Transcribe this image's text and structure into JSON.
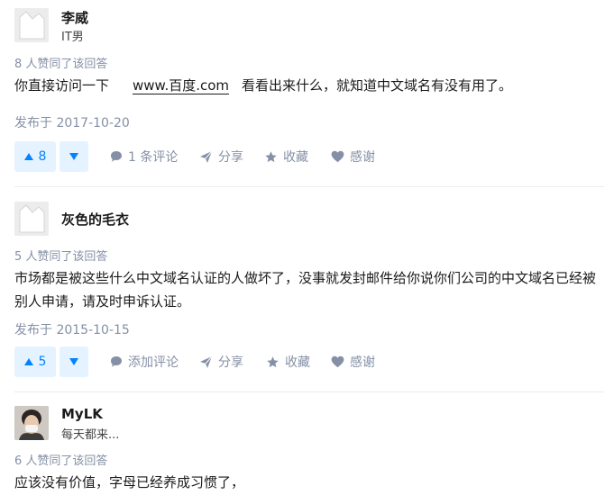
{
  "answers": [
    {
      "author_name": "李威",
      "author_bio": "IT男",
      "votes_text": "8 人赞同了该回答",
      "content_before": "你直接访问一下",
      "content_link": "www.百度.com",
      "content_after": "看看出来什么，就知道中文域名有没有用了。",
      "date": "发布于 2017-10-20",
      "vote_count": "8",
      "comment_label": "1 条评论",
      "share_label": "分享",
      "collect_label": "收藏",
      "thanks_label": "感谢"
    },
    {
      "author_name": "灰色的毛衣",
      "votes_text": "5 人赞同了该回答",
      "content_line1": "市场都是被这些什么中文域名认证的人做坏了，没事就发封邮件给你说你们公司的中文域名已经被",
      "content_line2": "别人申请，请及时申诉认证。",
      "date": "发布于 2015-10-15",
      "vote_count": "5",
      "comment_label": "添加评论",
      "share_label": "分享",
      "collect_label": "收藏",
      "thanks_label": "感谢"
    },
    {
      "author_name": "MyLK",
      "author_bio": "每天都来...",
      "votes_text": "6 人赞同了该回答",
      "content": "应该没有价值，字母已经养成习惯了，"
    }
  ],
  "colors": {
    "accent": "#0084ff",
    "vote_bg": "#e5f2ff",
    "meta": "#8590a6",
    "divider": "#ebebeb"
  },
  "icons": [
    "avatar-placeholder",
    "triangle-up-icon",
    "triangle-down-icon",
    "comment-icon",
    "paper-plane-icon",
    "star-icon",
    "heart-icon"
  ]
}
